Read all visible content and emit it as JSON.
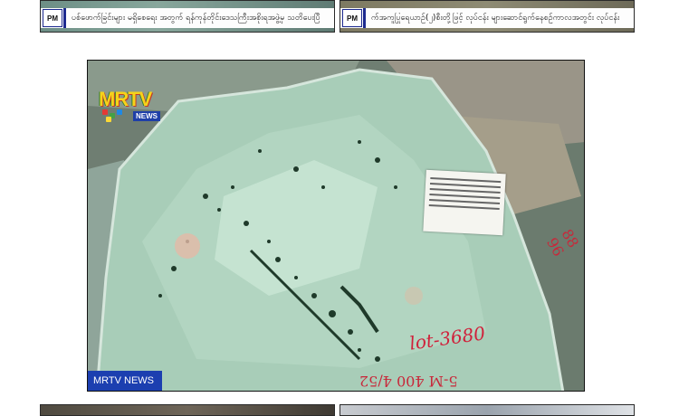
{
  "top_thumbnails": [
    {
      "badge": "PM",
      "headline": "ပစ်ဖောက်ခြင်းများ မရှိစေရေး အတွက် ရန်ကုန်တိုင်းဒေသကြီးအစိုးရအဖွဲ့မှ သတိပေးပြီ"
    },
    {
      "badge": "PM",
      "headline": "က်အကူပြုရေယာဉ်(၂)စီးတို့ဖြင့် လုပ်ငန်း များဆောင်ရွက်နေစဉ်ကာလအတွင်း လုပ်ငန်း"
    }
  ],
  "main_video": {
    "channel_logo": "MRTV",
    "logo_sub": "NEWS",
    "caption": "MRTV NEWS",
    "stone_markings": {
      "lot": "lot-3680",
      "side": "88 96",
      "bottom": "5-M 400 4/52"
    }
  },
  "colors": {
    "caption_bg": "#1c3fb0",
    "ticker_accent": "#1d2a8f",
    "marker_red": "#d0203a"
  }
}
